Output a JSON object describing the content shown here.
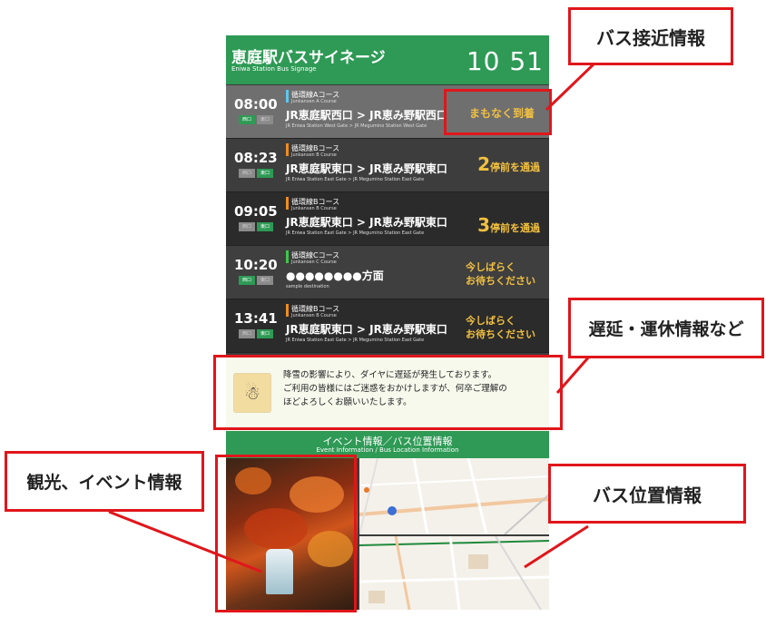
{
  "signage": {
    "title": "恵庭駅バスサイネージ",
    "subtitle": "Eniwa Station Bus Signage",
    "clock": "10 51",
    "departures": [
      {
        "time": "08:00",
        "gate_left": "西口",
        "gate_right": "東口",
        "active": "left",
        "course": "循環線Aコース",
        "course_en": "Junkansen A Course",
        "route": "JR恵庭駅西口 > JR恵み野駅西口",
        "route_en": "JR Eniwa Station West Gate > JR Megumino Station West Gate",
        "status": "まもなく到着",
        "color": "#5bc8f0"
      },
      {
        "time": "08:23",
        "gate_left": "西口",
        "gate_right": "東口",
        "active": "right",
        "course": "循環線Bコース",
        "course_en": "Junkansen B Course",
        "route": "JR恵庭駅東口 > JR恵み野駅東口",
        "route_en": "JR Eniwa Station East Gate > JR Megumino Station East Gate",
        "status_num": "2",
        "status_text": "停前を通過",
        "color": "#f08c1e"
      },
      {
        "time": "09:05",
        "gate_left": "西口",
        "gate_right": "東口",
        "active": "right",
        "course": "循環線Bコース",
        "course_en": "Junkansen B Course",
        "route": "JR恵庭駅東口 > JR恵み野駅東口",
        "route_en": "JR Eniwa Station East Gate > JR Megumino Station East Gate",
        "status_num": "3",
        "status_text": "停前を通過",
        "color": "#f08c1e"
      },
      {
        "time": "10:20",
        "gate_left": "西口",
        "gate_right": "東口",
        "active": "left",
        "course": "循環線Cコース",
        "course_en": "Junkansen C Course",
        "route": "●●●●●●●●方面",
        "route_en": "sample destination",
        "status_line1": "今しばらく",
        "status_line2": "お待ちください",
        "color": "#3cc84a"
      },
      {
        "time": "13:41",
        "gate_left": "西口",
        "gate_right": "東口",
        "active": "right",
        "course": "循環線Bコース",
        "course_en": "Junkansen B Course",
        "route": "JR恵庭駅東口 > JR恵み野駅東口",
        "route_en": "JR Eniwa Station East Gate > JR Megumino Station East Gate",
        "status_line1": "今しばらく",
        "status_line2": "お待ちください",
        "color": "#f08c1e"
      }
    ],
    "notice": {
      "line1": "降雪の影響により、ダイヤに遅延が発生しております。",
      "line2": "ご利用の皆様にはご迷惑をおかけしますが、何卒ご理解の",
      "line3": "ほどよろしくお願いいたします。"
    },
    "section_title": "イベント情報／バス位置情報",
    "section_subtitle": "Event Information / Bus Location Information"
  },
  "callouts": {
    "approach": "バス接近情報",
    "delay": "遅延・運休情報など",
    "tourism": "観光、イベント情報",
    "location": "バス位置情報"
  },
  "colors": {
    "accent_green": "#2e9a55",
    "status_yellow": "#f2c040",
    "callout_red": "#e0161b"
  }
}
